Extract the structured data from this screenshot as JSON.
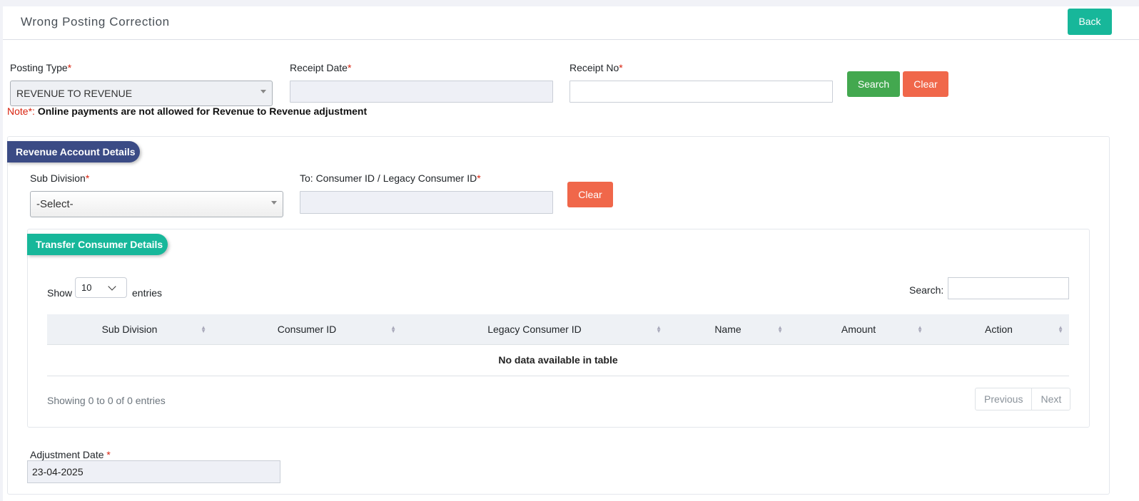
{
  "header": {
    "title": "Wrong Posting Correction",
    "back_label": "Back"
  },
  "form": {
    "posting_type_label": "Posting Type",
    "posting_type_value": "REVENUE TO REVENUE",
    "receipt_date_label": "Receipt Date",
    "receipt_date_value": "",
    "receipt_no_label": "Receipt No",
    "receipt_no_value": "",
    "search_label": "Search",
    "clear_label": "Clear",
    "required_mark": "*"
  },
  "note": {
    "prefix": "Note*:",
    "text": "Online payments are not allowed for Revenue to Revenue adjustment"
  },
  "revenue_section": {
    "title": "Revenue Account Details",
    "sub_division_label": "Sub Division",
    "sub_division_value": "-Select-",
    "consumer_label": "To: Consumer ID / Legacy Consumer ID",
    "consumer_value": "",
    "clear_label": "Clear"
  },
  "transfer_section": {
    "title": "Transfer Consumer Details",
    "show_label": "Show",
    "entries_value": "10",
    "entries_label": "entries",
    "search_label": "Search:",
    "columns": [
      "Sub Division",
      "Consumer ID",
      "Legacy Consumer ID",
      "Name",
      "Amount",
      "Action"
    ],
    "empty_message": "No data available in table",
    "info": "Showing 0 to 0 of 0 entries",
    "previous_label": "Previous",
    "next_label": "Next"
  },
  "adjustment": {
    "label": "Adjustment Date",
    "value": "23-04-2025"
  }
}
